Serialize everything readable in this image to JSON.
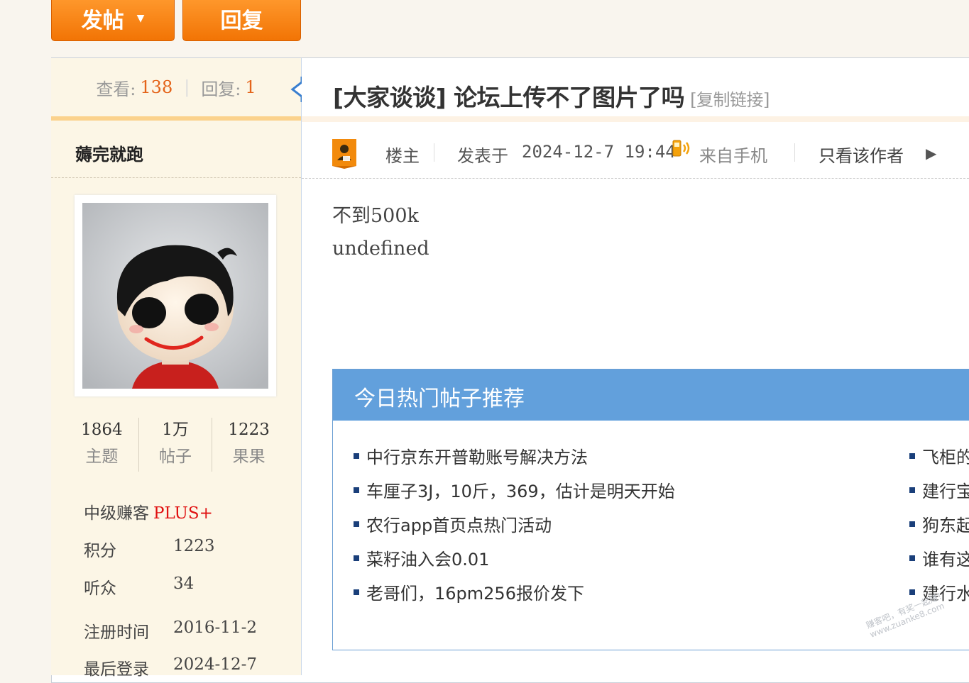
{
  "toolbar": {
    "new_post_label": "发帖",
    "reply_label": "回复"
  },
  "stats": {
    "views_label": "查看:",
    "views": "138",
    "replies_label": "回复:",
    "replies": "1"
  },
  "author": {
    "name": "薅完就跑",
    "counts": [
      {
        "value": "1864",
        "label": "主题"
      },
      {
        "value": "1万",
        "label": "帖子"
      },
      {
        "value": "1223",
        "label": "果果"
      }
    ],
    "level": "中级赚客",
    "level_badge": "PLUS+",
    "points_label": "积分",
    "points": "1223",
    "listeners_label": "听众",
    "listeners": "34",
    "registered_label": "注册时间",
    "registered": "2016-11-2",
    "last_login_label": "最后登录",
    "last_login": "2024-12-7"
  },
  "thread": {
    "title": "[大家谈谈] 论坛上传不了图片了吗",
    "copy_link": "[复制链接]"
  },
  "post_meta": {
    "host_label": "楼主",
    "posted_prefix": "发表于",
    "posted_time": "2024-12-7 19:44",
    "source": "来自手机",
    "only_author": "只看该作者"
  },
  "post_body": {
    "line1": "不到500k",
    "line2": "undefined"
  },
  "hot_box": {
    "title": "今日热门帖子推荐",
    "left_items": [
      "中行京东开普勒账号解决方法",
      "车厘子3J，10斤，369，估计是明天开始",
      "农行app首页点热门活动",
      "菜籽油入会0.01",
      "老哥们，16pm256报价发下"
    ],
    "right_items": [
      "飞柜的",
      "建行宝",
      "狗东起",
      "谁有这",
      "建行水"
    ]
  },
  "watermark": {
    "line1": "赚客吧，有奖一起赚！",
    "line2": "www.zuanke8.com"
  },
  "colors": {
    "accent_orange": "#f27405",
    "hot_header_blue": "#62a0dc",
    "number_orange": "#e4641a",
    "plus_red": "#e01010"
  }
}
